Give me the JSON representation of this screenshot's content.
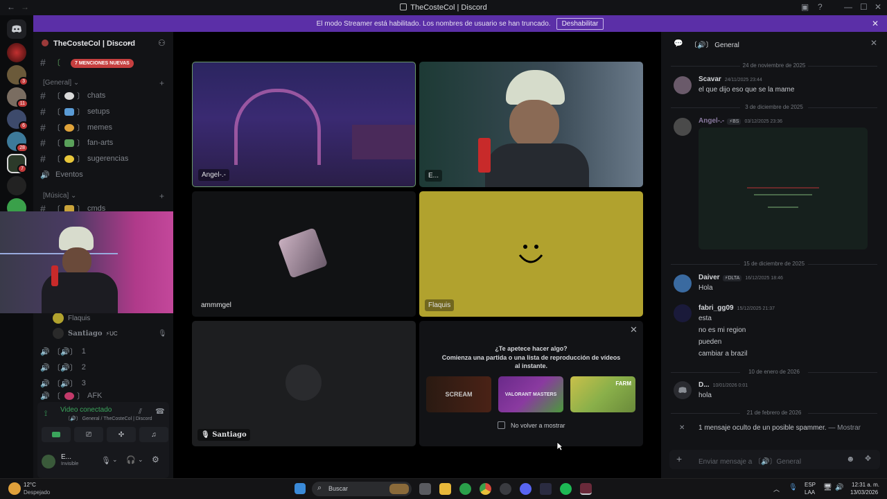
{
  "window": {
    "title": "TheCosteCol | Discord"
  },
  "banner": {
    "text": "El modo Streamer está habilitado. Los nombres de usuario se han truncado.",
    "button": "Deshabilitar"
  },
  "server": {
    "name": "TheCosteCol | Discord",
    "mentions_badge": "7 MENCIONES NUEVAS"
  },
  "rail": {
    "badges": [
      "3",
      "11",
      "6",
      "28",
      "7"
    ]
  },
  "sidebar": {
    "categories": [
      {
        "label": "[General]"
      },
      {
        "label": "[Música]"
      }
    ],
    "channels": [
      {
        "label": "chats"
      },
      {
        "label": "setups"
      },
      {
        "label": "memes"
      },
      {
        "label": "fan-arts"
      },
      {
        "label": "sugerencias"
      },
      {
        "label": "Eventos"
      },
      {
        "label": "cmds"
      }
    ],
    "voice_users": [
      {
        "name": "Flaquis"
      },
      {
        "name": "Santiago",
        "tag": "UC"
      }
    ],
    "voice_channels": [
      {
        "label": "1"
      },
      {
        "label": "2"
      },
      {
        "label": "3"
      },
      {
        "label": "AFK"
      }
    ]
  },
  "voice": {
    "status": "Video conectado",
    "location": "General / TheCosteCol | Discord"
  },
  "user": {
    "name": "E...",
    "status": "Invisible"
  },
  "tiles": [
    {
      "name": "Angel-.-"
    },
    {
      "name": "E..."
    },
    {
      "name": "ammmgel"
    },
    {
      "name": "Flaquis"
    },
    {
      "name": "Santiago"
    }
  ],
  "activity": {
    "title": "¿Te apetece hacer algo?",
    "subtitle": "Comienza una partida o una lista de reproducción de vídeos al instante.",
    "games": [
      "SCREAM",
      "VALORANT MASTERS",
      "FARM"
    ],
    "checkbox": "No volver a mostrar"
  },
  "chat": {
    "channel": "General",
    "dividers": [
      "24 de noviembre de 2025",
      "3 de diciembre de 2025",
      "15 de diciembre de 2025",
      "10 de enero de 2026",
      "21 de febrero de 2026"
    ],
    "messages": [
      {
        "author": "Scavar",
        "time": "24/11/2025 23:44",
        "lines": [
          "el que dijo eso que se la mame"
        ]
      },
      {
        "author": "Angel-.-",
        "tag": "BS",
        "time": "03/12/2025 23:36",
        "lines": []
      },
      {
        "author": "Daiver",
        "tag": "DLTA",
        "time": "16/12/2025 18:46",
        "lines": [
          "Hola"
        ]
      },
      {
        "author": "fabri_gg09",
        "time": "15/12/2025 21:37",
        "lines": [
          "esta",
          "no es mi region",
          "pueden",
          "cambiar a brazil"
        ]
      },
      {
        "author": "D...",
        "time": "10/01/2026 0:01",
        "lines": [
          "hola"
        ]
      }
    ],
    "spam_notice": "1 mensaje oculto de un posible spammer.",
    "spam_show": "— Mostrar",
    "input_placeholder": "Enviar mensaje a 〔🔊〕General"
  },
  "taskbar": {
    "weather_temp": "12°C",
    "weather_desc": "Despejado",
    "search": "Buscar",
    "lang": "ESP",
    "lang2": "LAA",
    "time": "12:31 a. m.",
    "date": "13/03/2026"
  },
  "colors": {
    "banner": "#5b2fa7",
    "mention": "#c63f3f",
    "voice_green": "#3ba55c",
    "flaquis_tile": "#b1a22e"
  }
}
